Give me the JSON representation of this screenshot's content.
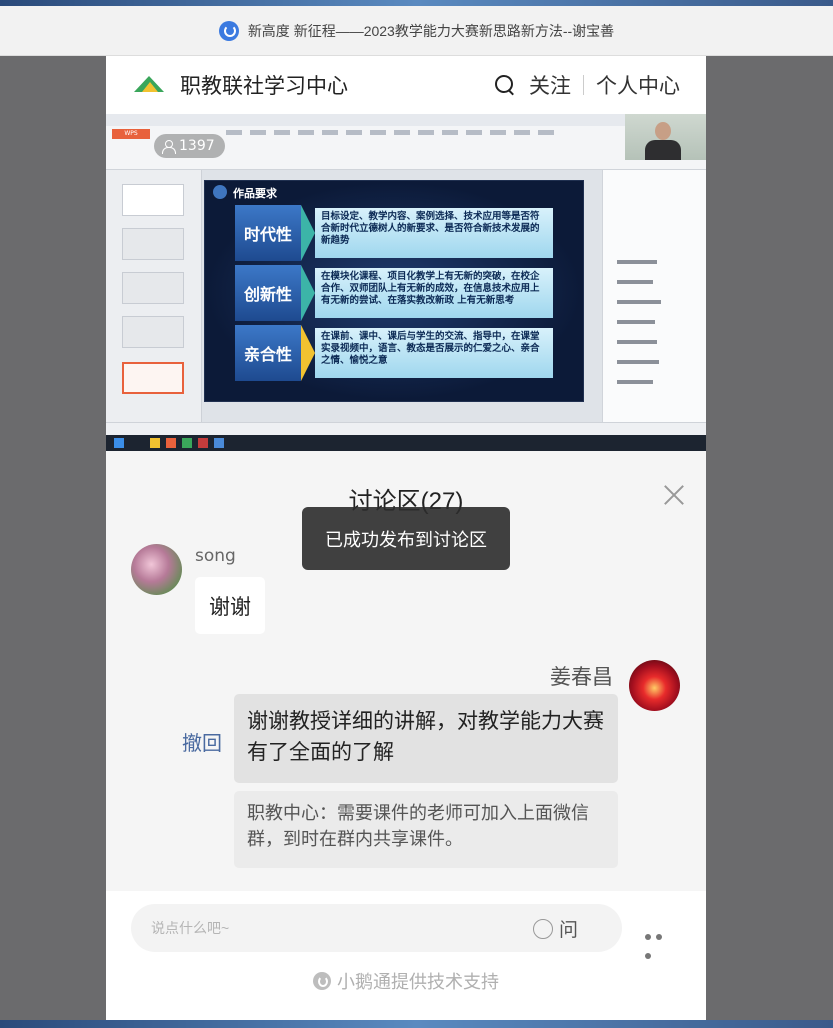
{
  "browser": {
    "tab_title": "新高度 新征程——2023教学能力大赛新思路新方法--谢宝善"
  },
  "header": {
    "title": "职教联社学习中心",
    "follow": "关注",
    "profile": "个人中心"
  },
  "video": {
    "viewer_count": "1397",
    "slide": {
      "title": "作品要求",
      "rows": [
        {
          "tag": "时代性",
          "text": "目标设定、教学内容、案例选择、技术应用等是否符合新时代立德树人的新要求、是否符合新技术发展的新趋势"
        },
        {
          "tag": "创新性",
          "text": "在模块化课程、项目化教学上有无新的突破，在校企合作、双师团队上有无新的成效，在信息技术应用上有无新的尝试、在落实教改新政 上有无新思考"
        },
        {
          "tag": "亲合性",
          "text": "在课前、课中、课后与学生的交流、指导中，在课堂实录视频中，语言、教态是否展示的仁爱之心、亲合之情、愉悦之意"
        }
      ]
    }
  },
  "discussion": {
    "title": "讨论区(27)",
    "toast": "已成功发布到讨论区",
    "messages": [
      {
        "author": "song",
        "text": "谢谢"
      },
      {
        "author": "姜春昌",
        "text": "谢谢教授详细的讲解，对教学能力大赛有了全面的了解",
        "recall": "撤回",
        "reply": "职教中心：需要课件的老师可加入上面微信群，到时在群内共享课件。"
      }
    ]
  },
  "footer": {
    "placeholder": "说点什么吧~",
    "ask": "问",
    "powered_by": "小鹅通提供技术支持"
  }
}
